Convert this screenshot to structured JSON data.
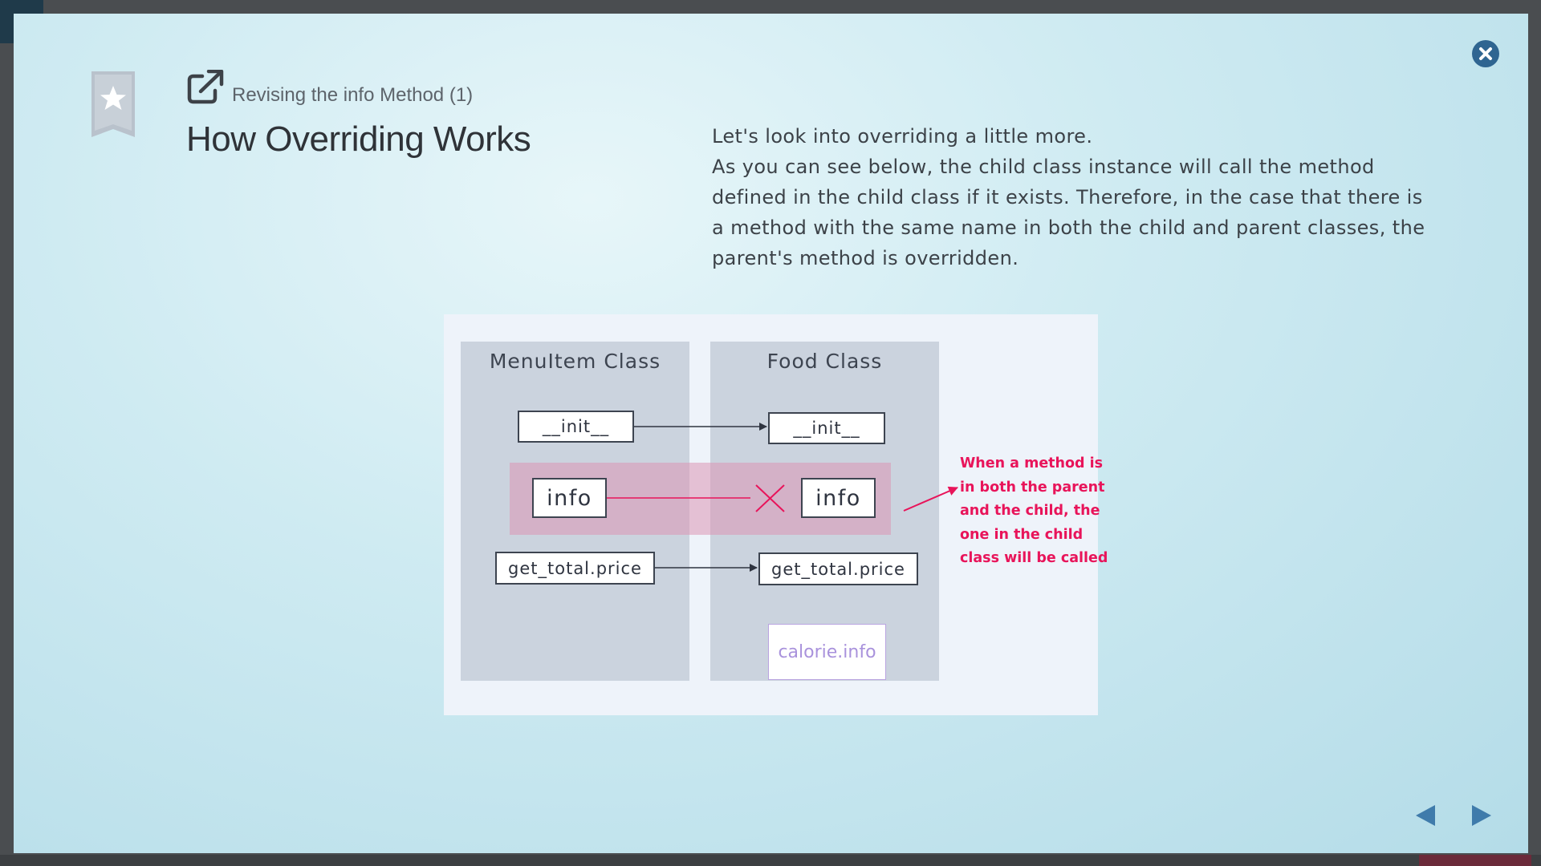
{
  "lesson": {
    "subtitle": "Revising the info Method (1)",
    "title": "How Overriding Works",
    "description": [
      "Let's look into overriding a little more.",
      "As you can see below, the child class instance will call the method defined in the child class if it exists. Therefore, in the case that there is a method with the same name in both the child and parent classes, the parent's method is overridden."
    ]
  },
  "diagram": {
    "parent_class": {
      "title": "MenuItem Class",
      "methods": [
        "__init__",
        "info",
        "get_total.price"
      ]
    },
    "child_class": {
      "title": "Food Class",
      "methods": [
        "__init__",
        "info",
        "get_total.price",
        "calorie.info"
      ]
    },
    "note": "When a method is in both the parent and the child, the one in the child class will be called",
    "colors": {
      "accent_pink": "#e8145a",
      "highlight": "#dc96b4",
      "class_panel": "#cbd3de",
      "new_method": "#a992dc"
    }
  },
  "icons": {
    "close": "close-icon",
    "bookmark": "bookmark-star-icon",
    "external": "external-link-icon",
    "prev": "arrow-left-icon",
    "next": "arrow-right-icon"
  }
}
